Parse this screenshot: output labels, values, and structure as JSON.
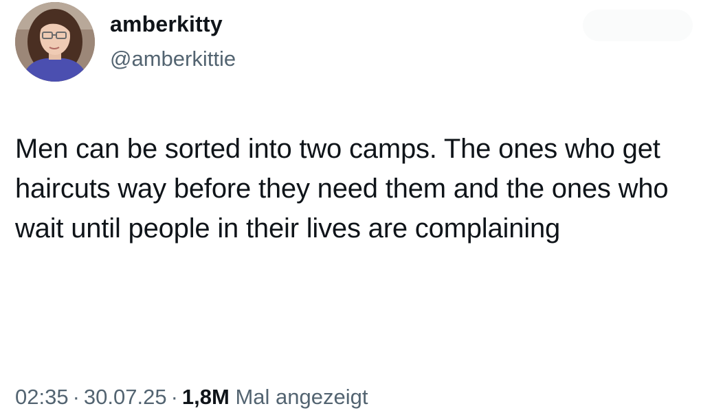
{
  "author": {
    "display_name": "amberkitty",
    "handle": "@amberkittie"
  },
  "tweet": {
    "text": "Men can be sorted into two camps. The ones who get haircuts way before they need them and the ones who wait until people in their lives are complaining"
  },
  "meta": {
    "time": "02:35",
    "separator": "·",
    "date": "30.07.25",
    "views_count": "1,8M",
    "views_label": "Mal angezeigt"
  },
  "icons": {
    "avatar": "profile-photo-icon"
  }
}
